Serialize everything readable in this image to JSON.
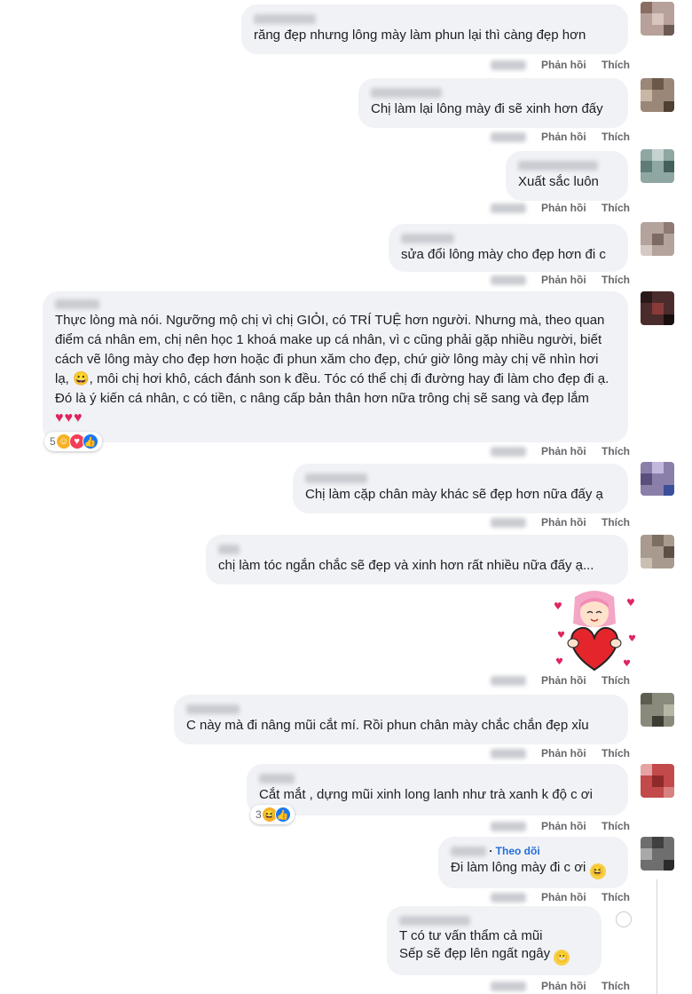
{
  "actions": {
    "like": "Thích",
    "reply": "Phản hồi"
  },
  "comments": [
    {
      "text": "răng đẹp nhưng lông mày làm phun lại thì càng đẹp hơn"
    },
    {
      "text": "Chị làm lại lông mày đi sẽ xinh hơn đấy"
    },
    {
      "text": "Xuất sắc luôn"
    },
    {
      "text": "sửa đổi lông mày cho đẹp hơn đi c"
    },
    {
      "text": "Thực lòng mà nói. Ngưỡng mộ chị vì chị GIỎI, có TRÍ TUỆ hơn người. Nhưng mà, theo quan điểm cá nhân em, chị nên học 1 khoá make up cá nhân, vì c cũng phải gặp nhiều người, biết cách vẽ lông mày cho đẹp hơn hoặc đi phun xăm cho đẹp, chứ giờ lông mày chị vẽ nhìn hơi lạ, 😀, môi chị hơi khô, cách đánh son k đều. Tóc có thể chị đi đường hay đi làm cho đẹp đi ạ. Đó là ý kiến cá nhân, c có tiền, c nâng cấp bản thân hơn nữa trông chị sẽ sang và đẹp lắm ♥♥♥",
      "reaction_count": "5"
    },
    {
      "text": "Chị làm cặp chân mày khác sẽ đẹp hơn nữa đấy ạ"
    },
    {
      "text": "chị làm tóc ngắn chắc sẽ đẹp và xinh hơn rất nhiều nữa đấy ạ..."
    },
    {
      "text": "C này mà đi nâng mũi cắt mí. Rồi phun chân mày chắc chắn đẹp xỉu"
    },
    {
      "text": "Cắt mắt , dựng mũi xinh long lanh như trà xanh k độ c ơi",
      "reaction_count": "3"
    },
    {
      "follow": "Theo dõi",
      "text": "Đi làm lông mày đi c ơi"
    },
    {
      "line1": "T       có tư vấn thẩm cả mũi",
      "line2": "Sếp sẽ đẹp lên ngất ngây"
    }
  ],
  "colors": {
    "bubble": "#f0f2f5",
    "action": "#65676b",
    "like": "#1877f2",
    "heart": "#e0245e",
    "link": "#216fdb"
  },
  "icons": [
    "like-reaction-icon",
    "haha-reaction-icon",
    "love-reaction-icon",
    "care-reaction-icon",
    "heart-hug-sticker"
  ]
}
